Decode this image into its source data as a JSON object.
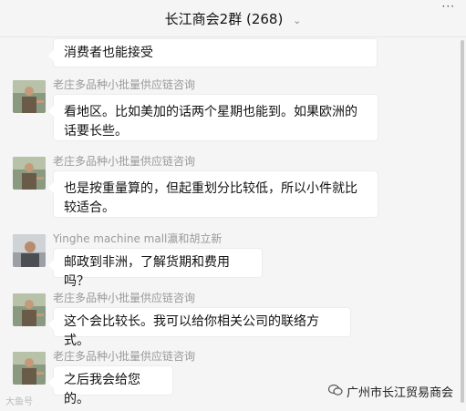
{
  "header": {
    "title": "长江商会2群",
    "count": "(268)",
    "chevron_icon": "chevron-down-icon",
    "window_controls": "···"
  },
  "messages": [
    {
      "sender": "",
      "text": "消费者也能接受"
    },
    {
      "sender": "老庄多品种小批量供应链咨询",
      "text": "看地区。比如美加的话两个星期也能到。如果欧洲的话要长些。"
    },
    {
      "sender": "老庄多品种小批量供应链咨询",
      "text": "也是按重量算的，但起重划分比较低，所以小件就比较适合。"
    },
    {
      "sender": "Yinghe machine mall瀛和胡立新",
      "text": "邮政到非洲，了解货期和费用吗？"
    },
    {
      "sender": "老庄多品种小批量供应链咨询",
      "text": "这个会比较长。我可以给你相关公司的联络方式。"
    },
    {
      "sender": "老庄多品种小批量供应链咨询",
      "text": "之后我会给您的。"
    }
  ],
  "watermarks": {
    "left": "大鱼号",
    "right": "广州市长江贸易商会",
    "right_icon": "wechat-official-icon"
  },
  "colors": {
    "background": "#f5f5f5",
    "bubble": "#ffffff",
    "sender_name": "#9a9a9a"
  }
}
